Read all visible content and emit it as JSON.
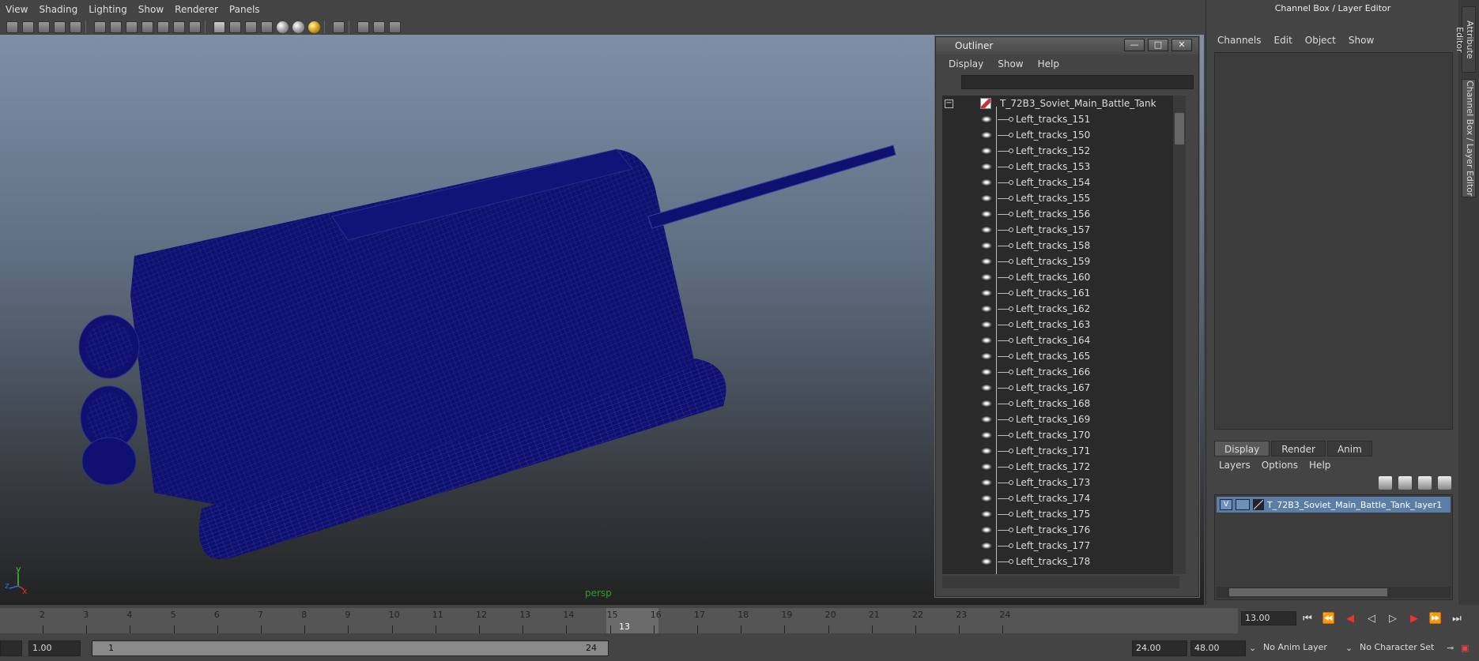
{
  "menubar": [
    "View",
    "Shading",
    "Lighting",
    "Show",
    "Renderer",
    "Panels"
  ],
  "viewport": {
    "camera_label": "persp",
    "axis": {
      "y": "y",
      "z": "z",
      "x": "x"
    }
  },
  "outliner": {
    "title": "Outliner",
    "menus": [
      "Display",
      "Show",
      "Help"
    ],
    "root": "T_72B3_Soviet_Main_Battle_Tank",
    "items": [
      "Left_tracks_151",
      "Left_tracks_150",
      "Left_tracks_152",
      "Left_tracks_153",
      "Left_tracks_154",
      "Left_tracks_155",
      "Left_tracks_156",
      "Left_tracks_157",
      "Left_tracks_158",
      "Left_tracks_159",
      "Left_tracks_160",
      "Left_tracks_161",
      "Left_tracks_162",
      "Left_tracks_163",
      "Left_tracks_164",
      "Left_tracks_165",
      "Left_tracks_166",
      "Left_tracks_167",
      "Left_tracks_168",
      "Left_tracks_169",
      "Left_tracks_170",
      "Left_tracks_171",
      "Left_tracks_172",
      "Left_tracks_173",
      "Left_tracks_174",
      "Left_tracks_175",
      "Left_tracks_176",
      "Left_tracks_177",
      "Left_tracks_178"
    ],
    "buttons": {
      "minimize": "—",
      "maximize": "□",
      "close": "✕"
    }
  },
  "channel_box": {
    "title": "Channel Box / Layer Editor",
    "menus": [
      "Channels",
      "Edit",
      "Object",
      "Show"
    ],
    "tabs": [
      "Display",
      "Render",
      "Anim"
    ],
    "layer_menus": [
      "Layers",
      "Options",
      "Help"
    ],
    "layer": {
      "visible": "V",
      "name": "T_72B3_Soviet_Main_Battle_Tank_layer1"
    }
  },
  "side_tabs": [
    "Attribute Editor",
    "Channel Box / Layer Editor"
  ],
  "time_slider": {
    "ticks": [
      2,
      3,
      4,
      5,
      6,
      7,
      8,
      9,
      10,
      11,
      12,
      13,
      14,
      15,
      16,
      17,
      18,
      19,
      20,
      21,
      22,
      23,
      24
    ],
    "current": "13",
    "current_field": "13.00"
  },
  "range": {
    "start_field": "1.00",
    "slider_start": "1",
    "slider_end": "24",
    "end_field": "24.00",
    "max_field": "48.00",
    "anim_layer": "No Anim Layer",
    "char_set": "No Character Set"
  },
  "colors": {
    "wireframe": "#0f1070",
    "viewport_top": "#7e8fa6",
    "selected_layer": "#5a7ea8"
  }
}
